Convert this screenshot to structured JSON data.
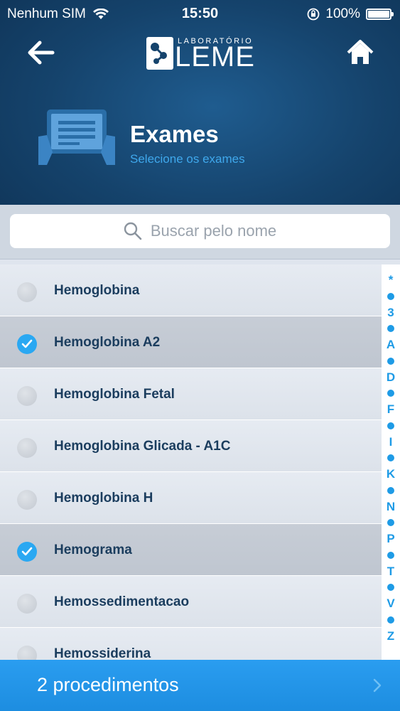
{
  "status_bar": {
    "carrier": "Nenhum SIM",
    "time": "15:50",
    "battery": "100%"
  },
  "logo": {
    "small_text": "LABORATÓRIO",
    "big_text": "LEME"
  },
  "header": {
    "title": "Exames",
    "subtitle": "Selecione os exames"
  },
  "search": {
    "placeholder": "Buscar pelo nome"
  },
  "exams": [
    {
      "label": "Hemoglobina",
      "selected": false
    },
    {
      "label": "Hemoglobina A2",
      "selected": true
    },
    {
      "label": "Hemoglobina Fetal",
      "selected": false
    },
    {
      "label": "Hemoglobina Glicada - A1C",
      "selected": false
    },
    {
      "label": "Hemoglobina H",
      "selected": false
    },
    {
      "label": "Hemograma",
      "selected": true
    },
    {
      "label": "Hemossedimentacao",
      "selected": false
    },
    {
      "label": "Hemossiderina",
      "selected": false
    }
  ],
  "index_letters": [
    "*",
    "3",
    "A",
    "D",
    "F",
    "I",
    "K",
    "N",
    "P",
    "T",
    "V",
    "Z"
  ],
  "footer": {
    "label": "2 procedimentos"
  },
  "colors": {
    "header_bg": "#15436c",
    "accent": "#2aa8f2",
    "subtitle": "#3fa8ec",
    "label_text": "#1b3d5e",
    "footer_bg": "#2196ea"
  },
  "icons": {
    "back": "arrow-left-icon",
    "home": "home-icon",
    "search": "search-icon",
    "exam": "tablet-document-icon",
    "check": "check-icon",
    "chevron": "chevron-right-icon"
  }
}
